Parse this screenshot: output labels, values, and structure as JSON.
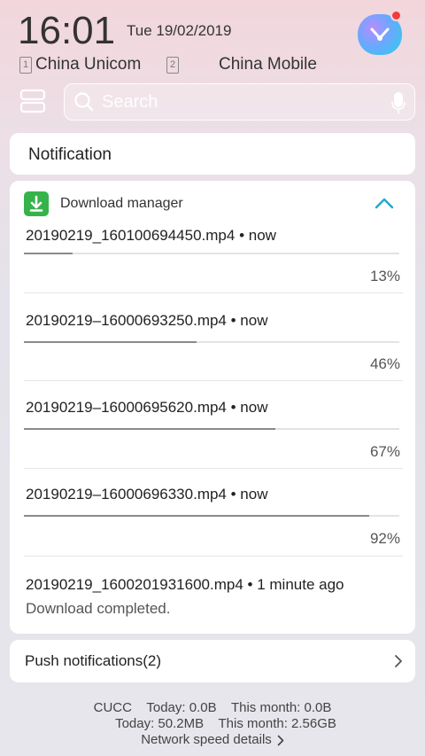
{
  "status": {
    "time": "16:01",
    "date": "Tue 19/02/2019",
    "sim1": {
      "slot": "1",
      "carrier": "China Unicom"
    },
    "sim2": {
      "slot": "2",
      "carrier": "China Mobile"
    }
  },
  "search": {
    "placeholder": "Search"
  },
  "notification_title": "Notification",
  "download_manager": {
    "title": "Download manager",
    "accent_color": "#35b34a",
    "downloads": [
      {
        "name": "20190219_160100694450.mp4",
        "time": "• now",
        "percent": "13%",
        "progress": 0.13
      },
      {
        "name": "20190219–16000693250.mp4",
        "time": "• now",
        "percent": "46%",
        "progress": 0.46
      },
      {
        "name": "20190219–16000695620.mp4",
        "time": "• now",
        "percent": "67%",
        "progress": 0.67
      },
      {
        "name": "20190219–16000696330.mp4",
        "time": "• now",
        "percent": "92%",
        "progress": 0.92
      }
    ],
    "completed": {
      "name": "20190219_1600201931600.mp4",
      "time": "• 1 minute ago",
      "status": "Download completed."
    }
  },
  "push_notifications": {
    "label": "Push notifications(2)"
  },
  "footer": {
    "line1": "CUCC    Today: 0.0B    This month: 0.0B",
    "line2": "Today: 50.2MB    This month: 2.56GB",
    "link": "Network speed details"
  }
}
